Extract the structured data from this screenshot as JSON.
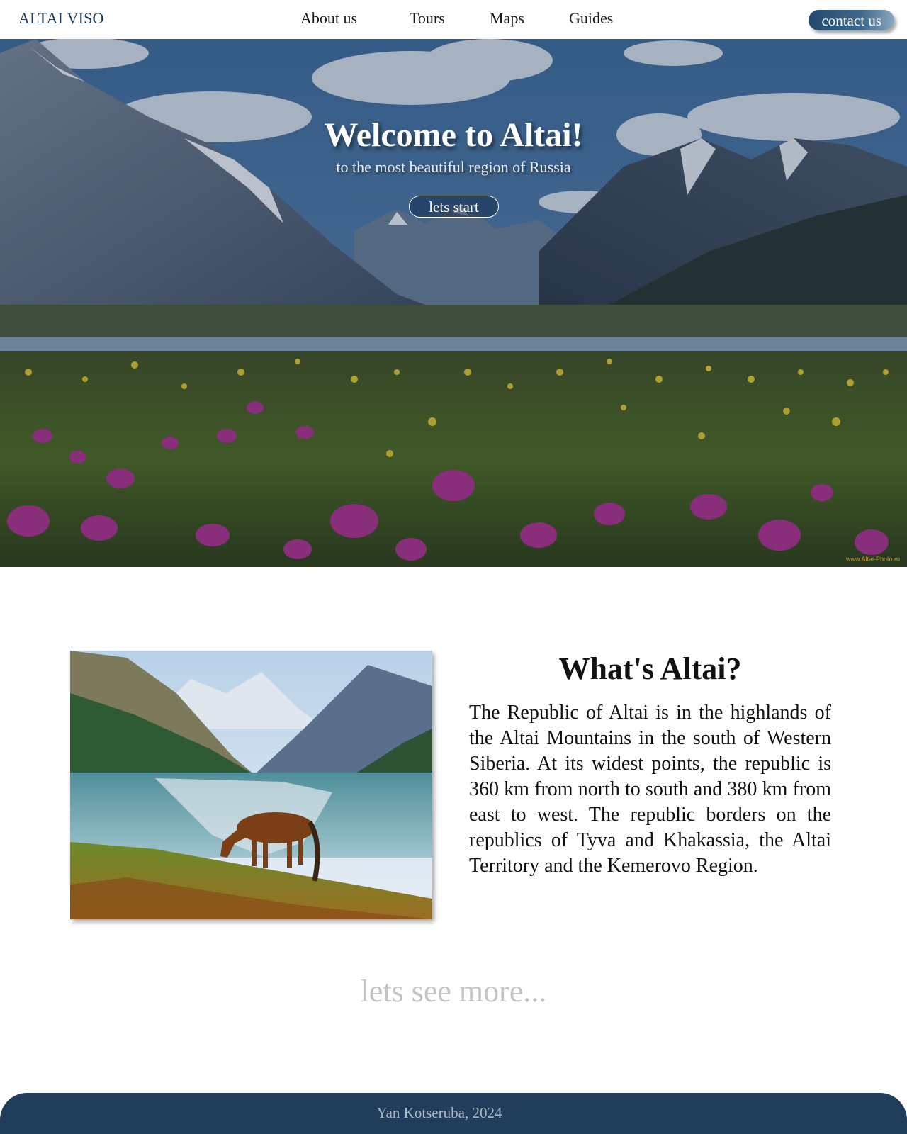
{
  "header": {
    "brand": "ALTAI VISO",
    "nav": [
      {
        "label": "About us"
      },
      {
        "label": "Tours"
      },
      {
        "label": "Maps"
      },
      {
        "label": "Guides"
      }
    ],
    "contact_label": "contact us"
  },
  "hero": {
    "title": "Welcome to Altai!",
    "subtitle": "to the most beautiful region of Russia",
    "cta_label": "lets start",
    "watermark": "www.Altai-Photo.ru",
    "image_icon": "mountain-meadow-photo"
  },
  "about": {
    "title": "What's Altai?",
    "text": "The Republic of Altai is in the highlands of the Altai Mountains in the south of Western Siberia. At its widest points, the republic is 360 km from north to south and 380 km from east to west. The republic borders on the republics of Tyva and Khakassia, the Altai Territory and the Kemerovo Region.",
    "image_icon": "horse-by-lake-photo"
  },
  "more": {
    "label": "lets see more..."
  },
  "footer": {
    "text": "Yan Kotseruba, 2024"
  },
  "colors": {
    "brand": "#1f3d5c",
    "footer_bg": "#203d5b",
    "muted": "#c4c4c4"
  }
}
